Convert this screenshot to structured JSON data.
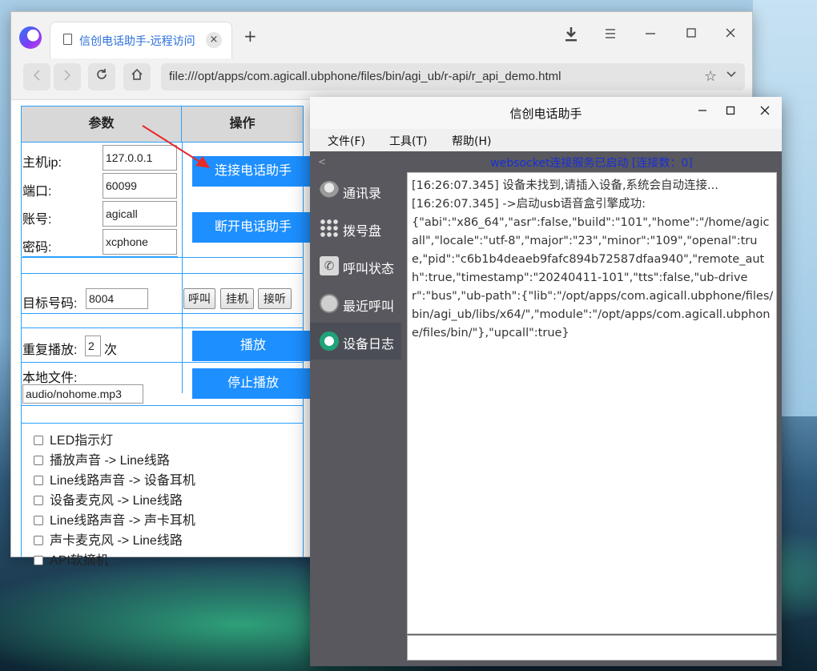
{
  "browser": {
    "tab_title": "信创电话助手-远程访问",
    "tab_close": "×",
    "new_tab": "+",
    "url": "file:///opt/apps/com.agicall.ubphone/files/bin/agi_ub/r-api/r_api_demo.html",
    "icons": {
      "back": "chevron-left-icon",
      "forward": "chevron-right-icon",
      "reload": "reload-icon",
      "home": "home-icon",
      "download": "download-icon",
      "menu": "hamburger-icon"
    }
  },
  "page": {
    "header_params": "参数",
    "header_ops": "操作",
    "host_label": "主机ip:",
    "host_value": "127.0.0.1",
    "port_label": "端口:",
    "port_value": "60099",
    "account_label": "账号:",
    "account_value": "agicall",
    "password_label": "密码:",
    "password_value": "xcphone",
    "connect_button": "连接电话助手",
    "disconnect_button": "断开电话助手",
    "target_label": "目标号码:",
    "target_value": "8004",
    "call_button": "呼叫",
    "hangup_button": "挂机",
    "answer_button": "接听",
    "repeat_label": "重复播放:",
    "repeat_value": "2",
    "repeat_unit": "次",
    "play_button": "播放",
    "local_file_label": "本地文件:",
    "local_file_value": "audio/nohome.mp3",
    "stop_button": "停止播放",
    "checkboxes": [
      "LED指示灯",
      "播放声音 -> Line线路",
      "Line线路声音 -> 设备耳机",
      "设备麦克风 -> Line线路",
      "Line线路声音 -> 声卡耳机",
      "声卡麦克风 -> Line线路",
      "API软摘机"
    ]
  },
  "app": {
    "title": "信创电话助手",
    "menus": [
      "文件(F)",
      "工具(T)",
      "帮助(H)"
    ],
    "collapse": "<",
    "nav": [
      {
        "label": "通讯录",
        "icon": "contacts-icon"
      },
      {
        "label": "拨号盘",
        "icon": "dialpad-icon"
      },
      {
        "label": "呼叫状态",
        "icon": "call-status-icon"
      },
      {
        "label": "最近呼叫",
        "icon": "recent-calls-icon"
      },
      {
        "label": "设备日志",
        "icon": "device-log-icon"
      }
    ],
    "status": "websocket连接服务已启动  [连接数：0]",
    "log": "[16:26:07.345] 设备未找到,请插入设备,系统会自动连接...\n[16:26:07.345] ->启动usb语音盒引擎成功:\n{\"abi\":\"x86_64\",\"asr\":false,\"build\":\"101\",\"home\":\"/home/agicall\",\"locale\":\"utf-8\",\"major\":\"23\",\"minor\":\"109\",\"openal\":true,\"pid\":\"c6b1b4deaeb9fafc894b72587dfaa940\",\"remote_auth\":true,\"timestamp\":\"20240411-101\",\"tts\":false,\"ub-driver\":\"bus\",\"ub-path\":{\"lib\":\"/opt/apps/com.agicall.ubphone/files/bin/agi_ub/libs/x64/\",\"module\":\"/opt/apps/com.agicall.ubphone/files/bin/\"},\"upcall\":true}",
    "arrows": "<<<<"
  },
  "colors": {
    "accent_blue": "#1d8fff",
    "status_blue": "#1a2fd8",
    "sidebar": "#58585e",
    "arrow_red": "#e01818"
  }
}
